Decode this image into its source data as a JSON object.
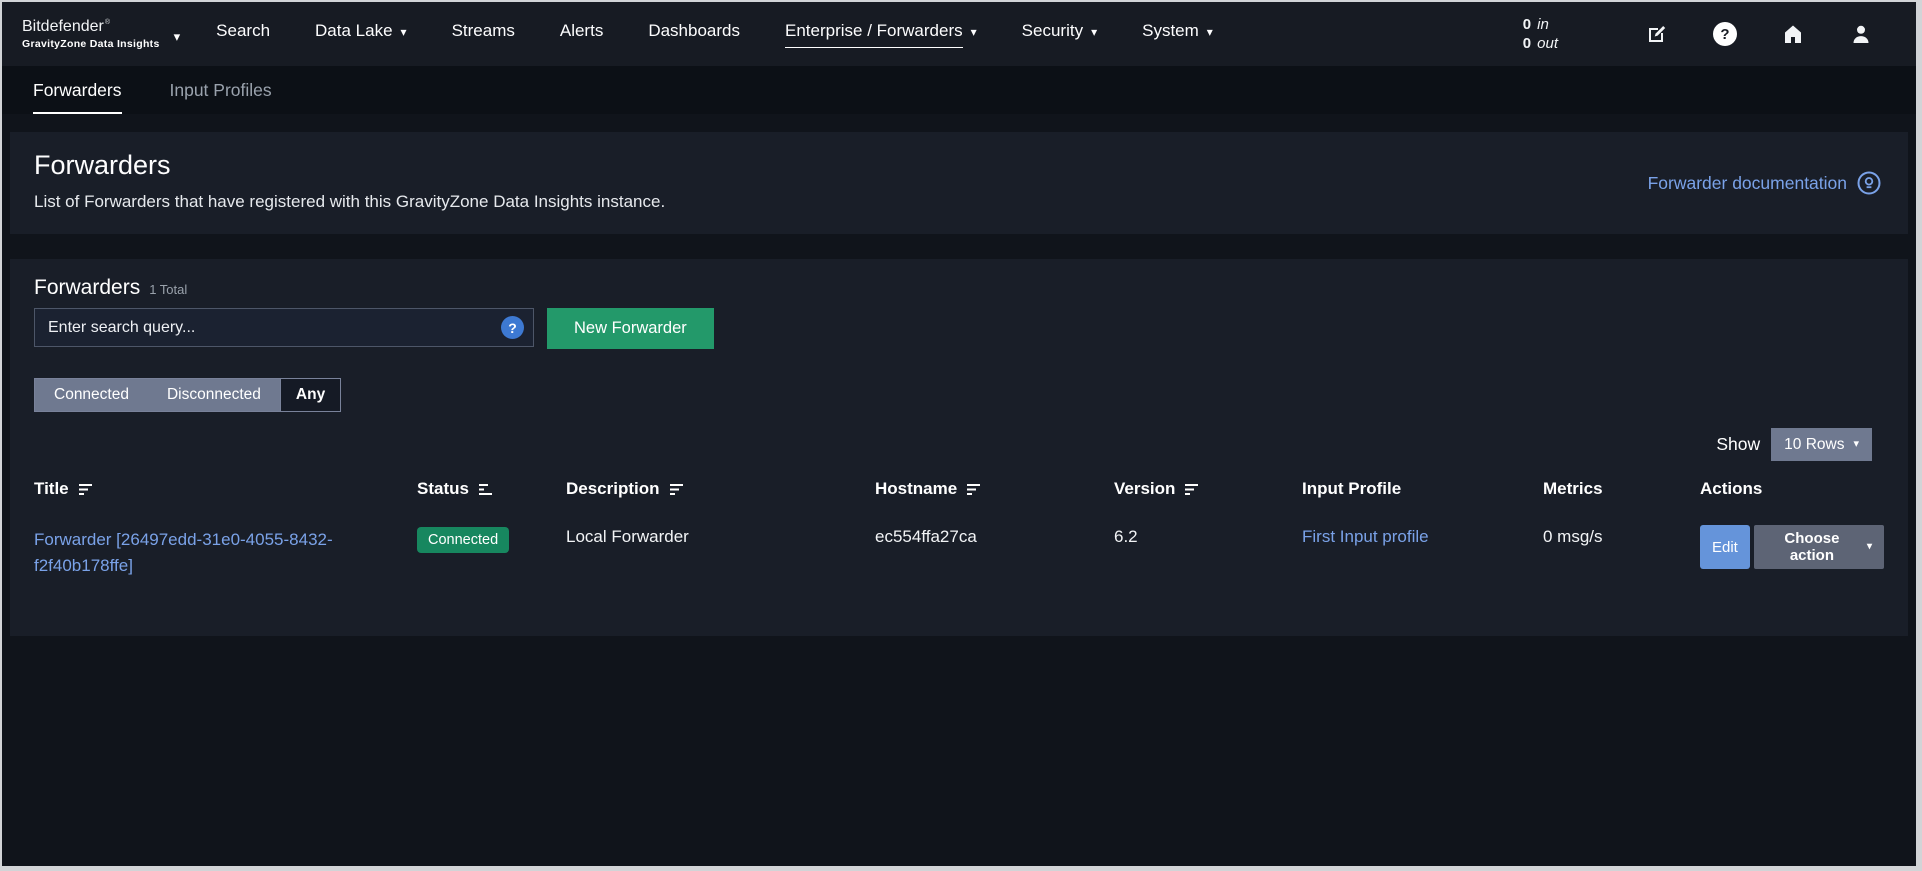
{
  "brand": {
    "name": "Bitdefender",
    "registered": "®",
    "subtitle": "GravityZone Data Insights"
  },
  "icons": {
    "caret_down": "▾",
    "question_mark": "?"
  },
  "navbar": {
    "items": [
      {
        "label": "Search"
      },
      {
        "label": "Data Lake"
      },
      {
        "label": "Streams"
      },
      {
        "label": "Alerts"
      },
      {
        "label": "Dashboards"
      },
      {
        "label": "Enterprise / Forwarders"
      },
      {
        "label": "Security"
      },
      {
        "label": "System"
      }
    ],
    "throughput": {
      "in_value": "0",
      "in_unit": "in",
      "out_value": "0",
      "out_unit": "out"
    }
  },
  "tabs": {
    "forwarders": "Forwarders",
    "input_profiles": "Input Profiles"
  },
  "page_header": {
    "title": "Forwarders",
    "subtitle": "List of Forwarders that have registered with this GravityZone Data Insights instance.",
    "doc_link_label": "Forwarder documentation"
  },
  "toolbar": {
    "section_title": "Forwarders",
    "total_label": "1 Total",
    "search_placeholder": "Enter search query...",
    "new_forwarder_label": "New Forwarder",
    "filters": {
      "connected": "Connected",
      "disconnected": "Disconnected",
      "any": "Any"
    },
    "show_label": "Show",
    "rows_per_page": "10 Rows"
  },
  "table": {
    "headers": {
      "title": "Title",
      "status": "Status",
      "description": "Description",
      "hostname": "Hostname",
      "version": "Version",
      "input_profile": "Input Profile",
      "metrics": "Metrics",
      "actions": "Actions"
    },
    "rows": [
      {
        "title": "Forwarder [26497edd-31e0-4055-8432-f2f40b178ffe]",
        "status": "Connected",
        "description": "Local Forwarder",
        "hostname": "ec554ffa27ca",
        "version": "6.2",
        "input_profile": "First Input profile",
        "metrics": "0 msg/s",
        "edit_label": "Edit",
        "choose_action_label": "Choose action"
      }
    ]
  },
  "colors": {
    "accent_green": "#23996a",
    "status_connected": "#17875f",
    "link_blue": "#7aa2e8",
    "edit_blue": "#6594da",
    "segment_gray": "#6f7990",
    "panel_bg": "#191e28",
    "navbar_bg": "#171b23"
  }
}
